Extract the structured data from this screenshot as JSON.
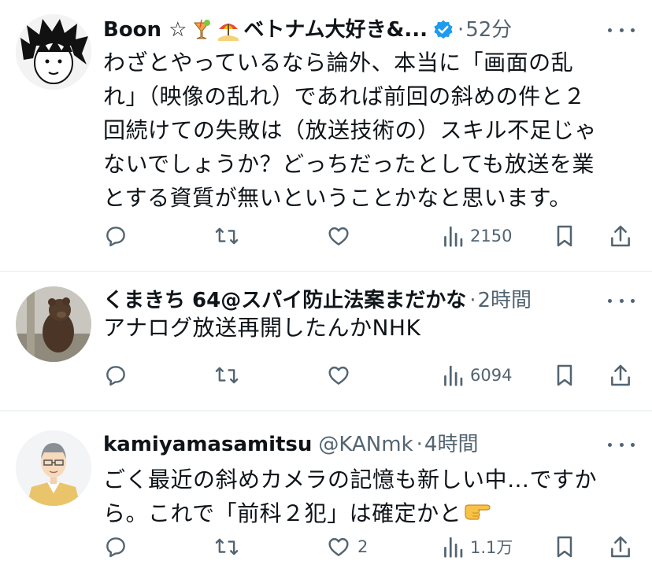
{
  "tweets": [
    {
      "name": "Boon ☆",
      "name_tail": "ベトナム大好き&...",
      "verified": true,
      "handle": "",
      "time": "52分",
      "text_lines": [
        "わざとやっているなら論外、本当に「画面の乱",
        "れ」（映像の乱れ）であれば前回の斜めの件と２",
        "回続けての失敗は（放送技術の）スキル不足じゃ",
        "ないでしょうか？どっちだったとしても放送を業",
        "とする資質が無いということかなと思います。"
      ],
      "reply_count": "",
      "retweet_count": "",
      "like_count": "",
      "views": "2150",
      "icons": [
        "cocktail-emoji",
        "beach-umbrella-emoji",
        "verified-badge-icon"
      ]
    },
    {
      "name": "くまきち 64@スパイ防止法案まだかな",
      "name_tail": "",
      "verified": false,
      "handle": "",
      "time": "2時間",
      "text_lines": [
        "アナログ放送再開したんかNHK"
      ],
      "reply_count": "",
      "retweet_count": "",
      "like_count": "",
      "views": "6094"
    },
    {
      "name": "kamiyamasamitsu",
      "name_tail": "",
      "verified": false,
      "handle": "@KANmk",
      "time": "4時間",
      "text_lines": [
        "ごく最近の斜めカメラの記憶も新しい中…ですか",
        "ら。これで「前科２犯」は確定かと"
      ],
      "trailing_emoji": "pointing-hand-emoji",
      "reply_count": "",
      "retweet_count": "",
      "like_count": "2",
      "views": "1.1万"
    }
  ],
  "colors": {
    "text": "#0f1419",
    "secondary": "#536471",
    "verified": "#1d9bf0",
    "divider": "#eff3f4"
  }
}
